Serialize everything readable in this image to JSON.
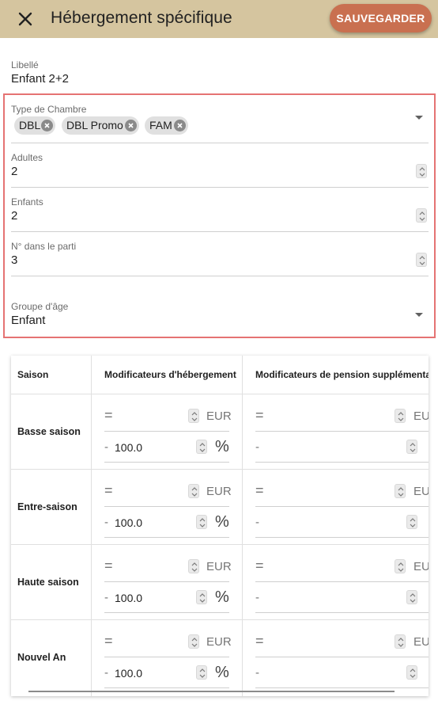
{
  "header": {
    "title": "Hébergement spécifique",
    "save_label": "SAUVEGARDER",
    "close_icon": "close-icon"
  },
  "form": {
    "libelle": {
      "label": "Libellé",
      "value": "Enfant 2+2"
    },
    "type_chambre": {
      "label": "Type de Chambre",
      "chips": [
        "DBL",
        "DBL Promo",
        "FAM"
      ]
    },
    "adultes": {
      "label": "Adultes",
      "value": "2"
    },
    "enfants": {
      "label": "Enfants",
      "value": "2"
    },
    "rang": {
      "label": "N° dans le parti",
      "value": "3"
    },
    "groupe_age": {
      "label": "Groupe d'âge",
      "value": "Enfant"
    }
  },
  "table": {
    "headers": [
      "Saison",
      "Modificateurs d'hébergement",
      "Modificateurs de pension supplémentaire"
    ],
    "rows": [
      {
        "season": "Basse saison",
        "accom_op1": "=",
        "accom_unit1": "EUR",
        "accom_op2": "-",
        "accom_val2": "100.0",
        "accom_unit2": "%",
        "board_op1": "=",
        "board_unit1": "EUR",
        "board_op2": "-"
      },
      {
        "season": "Entre-saison",
        "accom_op1": "=",
        "accom_unit1": "EUR",
        "accom_op2": "-",
        "accom_val2": "100.0",
        "accom_unit2": "%",
        "board_op1": "=",
        "board_unit1": "EUR",
        "board_op2": "-"
      },
      {
        "season": "Haute saison",
        "accom_op1": "=",
        "accom_unit1": "EUR",
        "accom_op2": "-",
        "accom_val2": "100.0",
        "accom_unit2": "%",
        "board_op1": "=",
        "board_unit1": "EUR",
        "board_op2": "-"
      },
      {
        "season": "Nouvel An",
        "accom_op1": "=",
        "accom_unit1": "EUR",
        "accom_op2": "-",
        "accom_val2": "100.0",
        "accom_unit2": "%",
        "board_op1": "=",
        "board_unit1": "EUR",
        "board_op2": "-"
      }
    ]
  },
  "colors": {
    "header_bg": "#d5c59f",
    "save_button": "#c97050",
    "highlight_border": "#e57373"
  }
}
